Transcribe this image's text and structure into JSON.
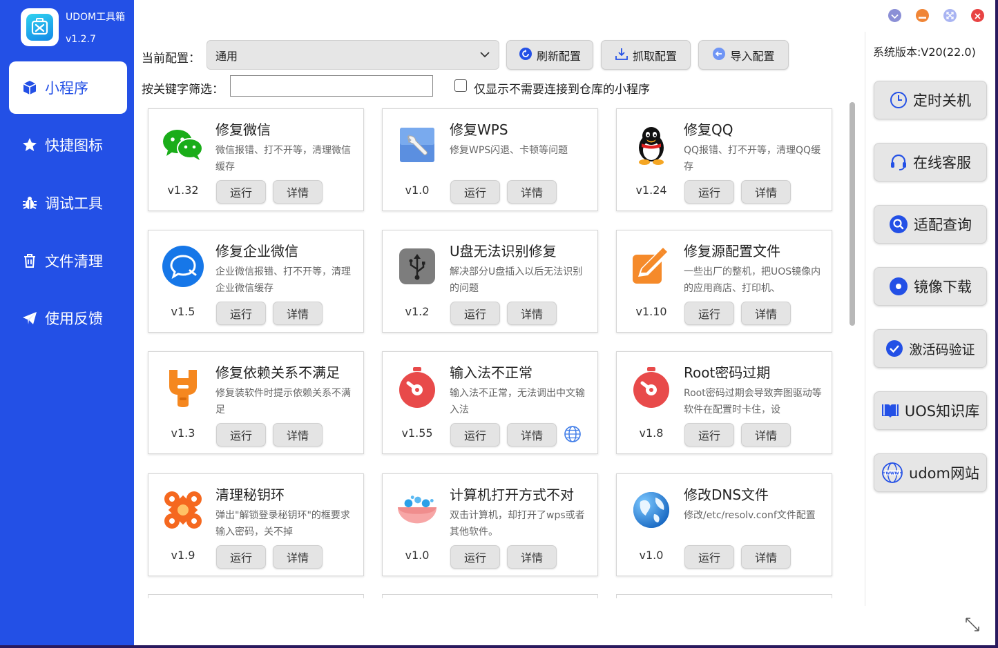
{
  "app": {
    "name": "UDOM工具箱",
    "version": "v1.2.7"
  },
  "colors": {
    "sidebar": "#2350e6",
    "accent": "#2350e6"
  },
  "nav": [
    {
      "label": "小程序",
      "icon": "cube-icon",
      "active": true
    },
    {
      "label": "快捷图标",
      "icon": "star-icon"
    },
    {
      "label": "调试工具",
      "icon": "bug-icon"
    },
    {
      "label": "文件清理",
      "icon": "trash-icon"
    },
    {
      "label": "使用反馈",
      "icon": "send-icon"
    }
  ],
  "config": {
    "current_label": "当前配置：",
    "current_value": "通用",
    "refresh_label": "刷新配置",
    "fetch_label": "抓取配置",
    "import_label": "导入配置",
    "filter_label": "按关键字筛选：",
    "filter_value": "",
    "checkbox_label": "仅显示不需要连接到仓库的小程序"
  },
  "cards": [
    {
      "title": "修复微信",
      "desc": "微信报错、打不开等，清理微信缓存",
      "version": "v1.32",
      "icon": "wechat-icon"
    },
    {
      "title": "修复WPS",
      "desc": "修复WPS闪退、卡顿等问题",
      "version": "v1.0",
      "icon": "wrench-icon"
    },
    {
      "title": "修复QQ",
      "desc": "QQ报错、打不开等，清理QQ缓存",
      "version": "v1.24",
      "icon": "qq-penguin-icon"
    },
    {
      "title": "修复企业微信",
      "desc": "企业微信报错、打不开等，清理企业微信缓存",
      "version": "v1.5",
      "icon": "wecom-icon"
    },
    {
      "title": "U盘无法识别修复",
      "desc": "解决部分U盘插入以后无法识别的问题",
      "version": "v1.2",
      "icon": "usb-icon"
    },
    {
      "title": "修复源配置文件",
      "desc": "一些出厂的整机，把UOS镜像内的应用商店、打印机、",
      "version": "v1.10",
      "icon": "pencil-icon"
    },
    {
      "title": "修复依赖关系不满足",
      "desc": "修复装软件时提示依赖关系不满足",
      "version": "v1.3",
      "icon": "tool-icon"
    },
    {
      "title": "输入法不正常",
      "desc": "输入法不正常，无法调出中文输入法",
      "version": "v1.55",
      "icon": "stopwatch-icon",
      "globe": true
    },
    {
      "title": "Root密码过期",
      "desc": "Root密码过期会导致奔图驱动等软件在配置时卡住，设",
      "version": "v1.8",
      "icon": "stopwatch-icon"
    },
    {
      "title": "清理秘钥环",
      "desc": "弹出\"解锁登录秘钥环\"的框要求输入密码，关不掉",
      "version": "v1.9",
      "icon": "keyring-icon"
    },
    {
      "title": "计算机打开方式不对",
      "desc": "双击计算机，却打开了wps或者其他软件。",
      "version": "v1.0",
      "icon": "bowl-icon"
    },
    {
      "title": "修改DNS文件",
      "desc": "修改/etc/resolv.conf文件配置",
      "version": "v1.0",
      "icon": "earth-icon"
    }
  ],
  "card_buttons": {
    "run": "运行",
    "details": "详情"
  },
  "right": {
    "system_version": "系统版本:V20(22.0)",
    "buttons": [
      {
        "label": "定时关机",
        "icon": "clock-icon"
      },
      {
        "label": "在线客服",
        "icon": "headset-icon"
      },
      {
        "label": "适配查询",
        "icon": "search-icon"
      },
      {
        "label": "镜像下载",
        "icon": "disc-icon"
      },
      {
        "label": "激活码验证",
        "icon": "check-icon"
      },
      {
        "label": "UOS知识库",
        "icon": "book-icon"
      },
      {
        "label": "udom网站",
        "icon": "www-globe-icon"
      }
    ]
  }
}
